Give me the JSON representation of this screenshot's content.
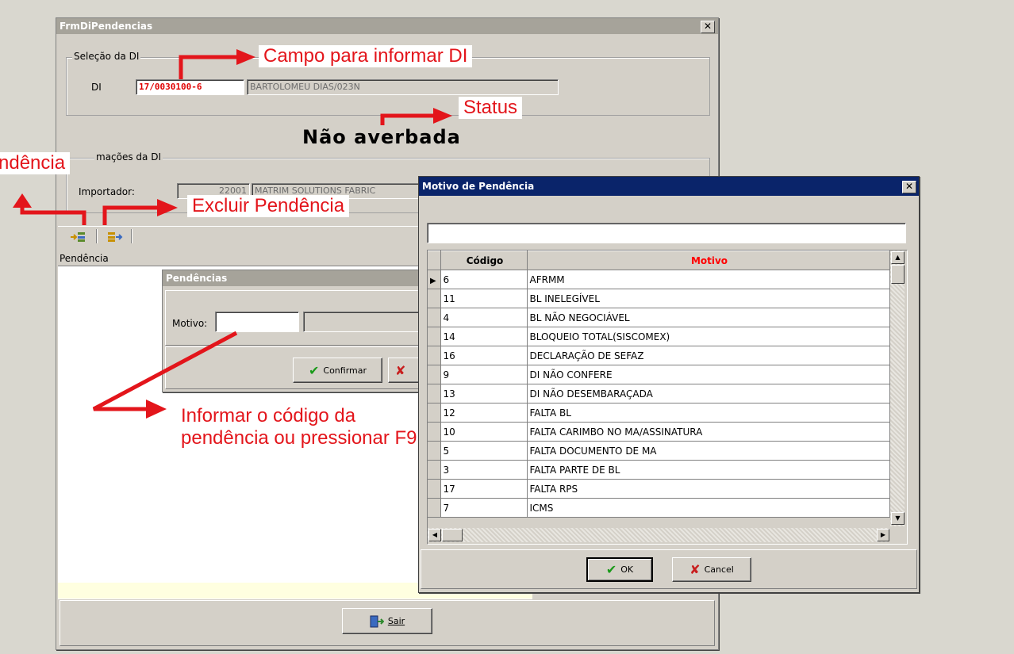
{
  "main_window": {
    "title": "FrmDiPendencias",
    "selecao_label": "Seleção da DI",
    "di_label": "DI",
    "di_value": "17/0030100-6",
    "di_desc": "BARTOLOMEU DIAS/023N",
    "status_text": "Não averbada",
    "info_label": "mações da DI",
    "importador_label": "Importador:",
    "importador_code": "22001",
    "importador_name": "MATRIM SOLUTIONS  FABRIC",
    "pendencia_label": "Pendência",
    "sair_label": "Sair"
  },
  "pendencias_dialog": {
    "title": "Pendências",
    "motivo_label": "Motivo:",
    "motivo_value": "",
    "confirmar_label": "Confirmar"
  },
  "motivo_dialog": {
    "title": "Motivo de Pendência",
    "search_value": "",
    "columns": [
      "Código",
      "Motivo"
    ],
    "rows": [
      {
        "codigo": "6",
        "motivo": "AFRMM"
      },
      {
        "codigo": "11",
        "motivo": "BL INELEGÍVEL"
      },
      {
        "codigo": "4",
        "motivo": "BL NÃO NEGOCIÁVEL"
      },
      {
        "codigo": "14",
        "motivo": "BLOQUEIO TOTAL(SISCOMEX)"
      },
      {
        "codigo": "16",
        "motivo": "DECLARAÇÃO DE SEFAZ"
      },
      {
        "codigo": "9",
        "motivo": "DI NÃO CONFERE"
      },
      {
        "codigo": "13",
        "motivo": "DI NÃO DESEMBARAÇADA"
      },
      {
        "codigo": "12",
        "motivo": "FALTA BL"
      },
      {
        "codigo": "10",
        "motivo": "FALTA CARIMBO NO MA/ASSINATURA"
      },
      {
        "codigo": "5",
        "motivo": "FALTA DOCUMENTO DE MA"
      },
      {
        "codigo": "3",
        "motivo": "FALTA PARTE DE BL"
      },
      {
        "codigo": "17",
        "motivo": "FALTA RPS"
      },
      {
        "codigo": "7",
        "motivo": "ICMS"
      }
    ],
    "ok_label": "OK",
    "cancel_label": "Cancel"
  },
  "annotations": {
    "campo_di": "Campo para informar DI",
    "status": "Status",
    "incluir": "ndência",
    "excluir": "Excluir Pendência",
    "informar": "Informar o código da pendência ou pressionar F9"
  },
  "colors": {
    "annotation_red": "#e3151b",
    "active_title": "#0a246a",
    "inactive_title": "#a6a39a",
    "motivo_header": "#ff0000"
  },
  "icons": [
    "close-icon",
    "add-pendencia-icon",
    "remove-pendencia-icon",
    "check-icon",
    "x-icon",
    "door-exit-icon",
    "row-pointer-icon",
    "arrow-up-icon",
    "arrow-down-icon",
    "arrow-left-icon",
    "arrow-right-icon"
  ]
}
